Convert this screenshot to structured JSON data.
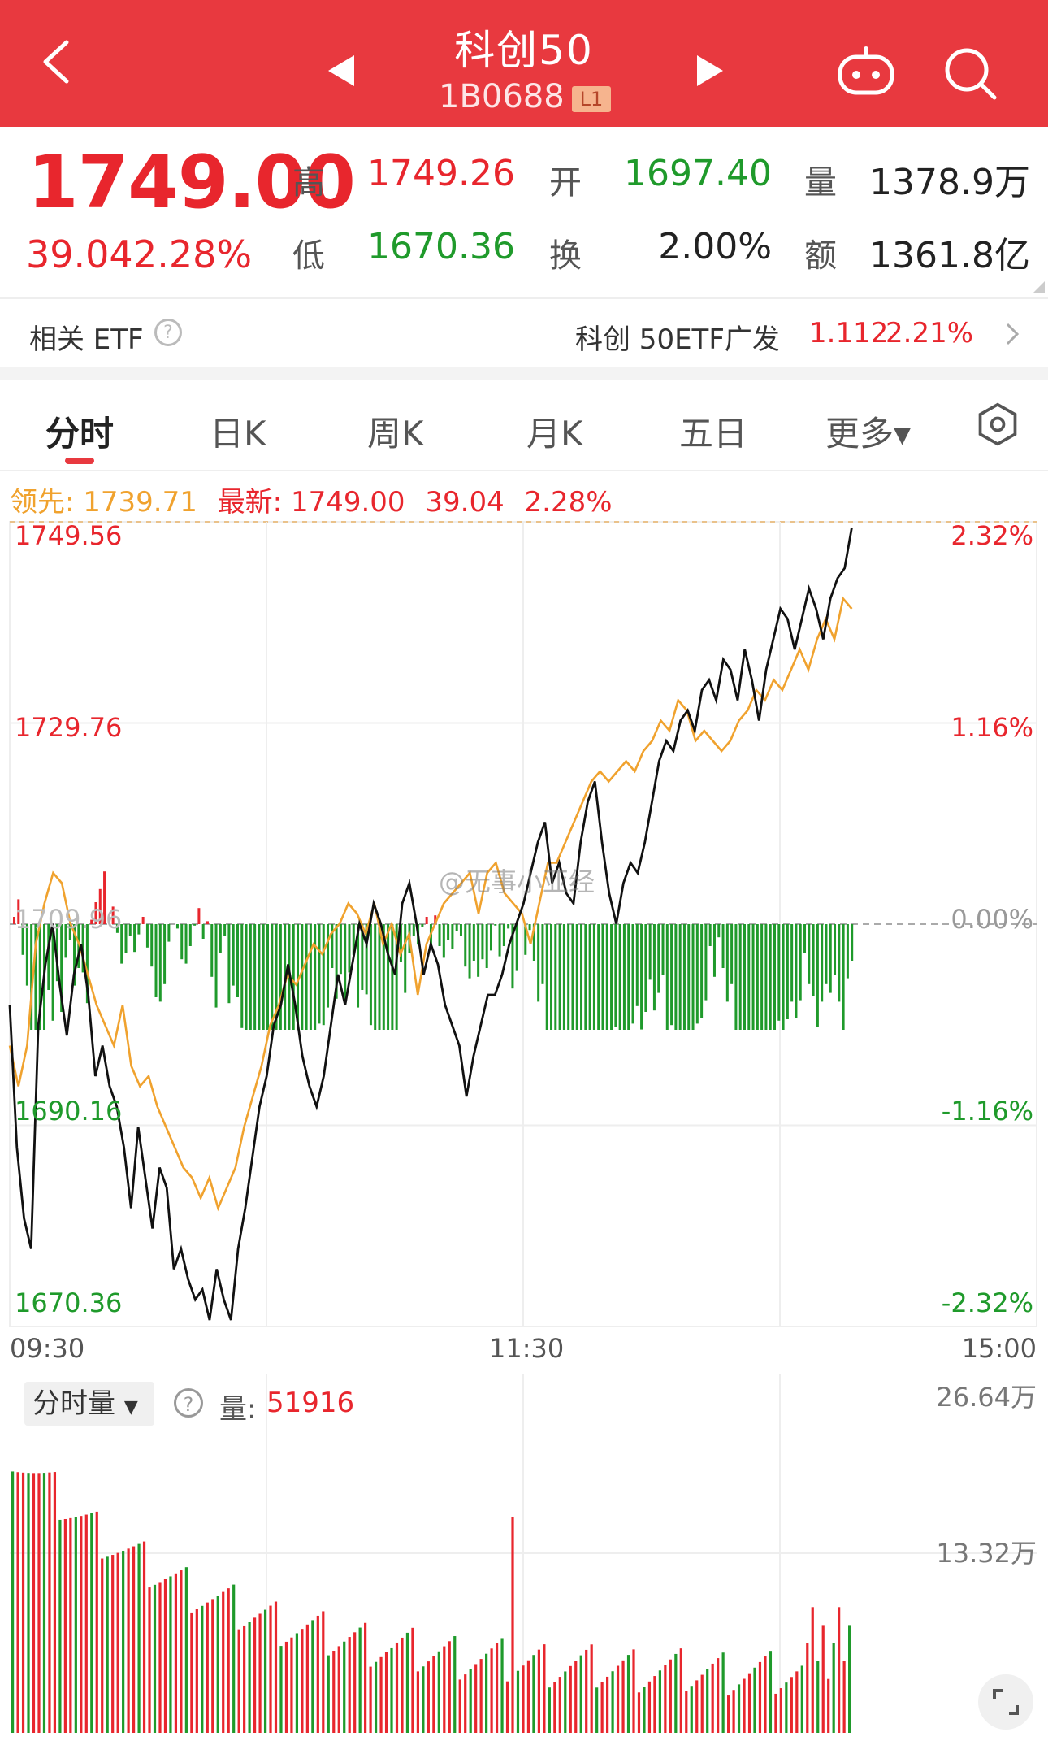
{
  "header": {
    "title": "科创50",
    "code": "1B0688",
    "badge": "L1"
  },
  "quote": {
    "price": "1749.00",
    "change": "39.04",
    "change_pct": "2.28%",
    "high_label": "高",
    "high": "1749.26",
    "open_label": "开",
    "open": "1697.40",
    "volume_label": "量",
    "volume": "1378.9万",
    "low_label": "低",
    "low": "1670.36",
    "turnover_label": "换",
    "turnover": "2.00%",
    "amount_label": "额",
    "amount": "1361.8亿"
  },
  "etf": {
    "label": "相关 ETF",
    "name": "科创 50ETF广发",
    "price": "1.112",
    "pct": "2.21%"
  },
  "tabs": [
    "分时",
    "日K",
    "周K",
    "月K",
    "五日",
    "更多▾"
  ],
  "legend": {
    "lead_label": "领先: 1739.71",
    "latest_label": "最新: 1749.00",
    "latest_chg": "39.04",
    "latest_pct": "2.28%"
  },
  "axes": {
    "y_left": [
      "1749.56",
      "1729.76",
      "1709.96",
      "1690.16",
      "1670.36"
    ],
    "y_right": [
      "2.32%",
      "1.16%",
      "0.00%",
      "-1.16%",
      "-2.32%"
    ],
    "x": [
      "09:30",
      "11:30",
      "15:00"
    ]
  },
  "volume_panel": {
    "selector": "分时量",
    "label": "量:",
    "value": "51916",
    "y_right": [
      "26.64万",
      "13.32万"
    ]
  },
  "watermark": "@无事小亚经",
  "colors": {
    "brand": "#e8393f",
    "up": "#e8262d",
    "down": "#1f9a2b",
    "lead": "#f0a22e"
  },
  "chart_data": {
    "type": "line",
    "ylim": [
      1670.36,
      1749.56
    ],
    "prev_close": 1709.96,
    "series": [
      {
        "values": [
          1702,
          1688,
          1681,
          1678,
          1700,
          1706,
          1710,
          1704,
          1699,
          1705,
          1708,
          1703,
          1695,
          1698,
          1694,
          1692,
          1688,
          1682,
          1690,
          1685,
          1680,
          1686,
          1684,
          1676,
          1678,
          1675,
          1673,
          1674,
          1671,
          1676,
          1673,
          1671,
          1678,
          1682,
          1687,
          1692,
          1695,
          1700,
          1702,
          1706,
          1702,
          1697,
          1694,
          1692,
          1695,
          1700,
          1705,
          1702,
          1706,
          1710,
          1708,
          1712,
          1710,
          1707,
          1705,
          1712,
          1714,
          1710,
          1705,
          1708,
          1706,
          1702,
          1700,
          1698,
          1693,
          1697,
          1700,
          1703,
          1703,
          1705,
          1708,
          1710,
          1712,
          1715,
          1718,
          1720,
          1714,
          1716,
          1713,
          1712,
          1718,
          1722,
          1724,
          1718,
          1713,
          1710,
          1714,
          1716,
          1715,
          1718,
          1722,
          1726,
          1728,
          1727,
          1730,
          1731,
          1729,
          1733,
          1734,
          1732,
          1736,
          1735,
          1732,
          1737,
          1734,
          1730,
          1735,
          1738,
          1741,
          1740,
          1737,
          1740,
          1743,
          1741,
          1738,
          1742,
          1744,
          1745,
          1749
        ]
      },
      {
        "values": [
          1698,
          1694,
          1698,
          1708,
          1712,
          1715,
          1714,
          1710,
          1708,
          1705,
          1702,
          1700,
          1698,
          1702,
          1696,
          1694,
          1695,
          1692,
          1690,
          1688,
          1686,
          1685,
          1683,
          1685,
          1682,
          1684,
          1686,
          1690,
          1693,
          1696,
          1700,
          1702,
          1705,
          1704,
          1706,
          1708,
          1707,
          1709,
          1710,
          1712,
          1711,
          1709,
          1712,
          1708,
          1710,
          1707,
          1709,
          1703,
          1708,
          1710,
          1712,
          1713,
          1714,
          1715,
          1711,
          1715,
          1716,
          1713,
          1712,
          1711,
          1708,
          1712,
          1716,
          1716,
          1718,
          1720,
          1722,
          1724,
          1725,
          1724,
          1725,
          1726,
          1725,
          1727,
          1728,
          1730,
          1729,
          1732,
          1731,
          1728,
          1729,
          1728,
          1727,
          1728,
          1730,
          1731,
          1733,
          1732,
          1734,
          1733,
          1735,
          1737,
          1735,
          1738,
          1740,
          1738,
          1742,
          1741
        ]
      }
    ]
  }
}
